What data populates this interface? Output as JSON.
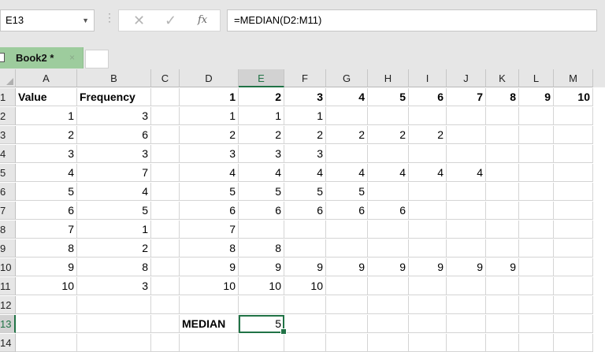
{
  "formula_bar": {
    "name_box": "E13",
    "name_box_arrow": "▼",
    "separator": "⋮",
    "cancel_icon": "✕",
    "enter_icon": "✓",
    "fx_label": "fx",
    "formula": "=MEDIAN(D2:M11)"
  },
  "workbook_tab": {
    "label": "Book2 *",
    "close": "×"
  },
  "columns": [
    "A",
    "B",
    "C",
    "D",
    "E",
    "F",
    "G",
    "H",
    "I",
    "J",
    "K",
    "L",
    "M"
  ],
  "row_numbers": [
    "1",
    "2",
    "3",
    "4",
    "5",
    "6",
    "7",
    "8",
    "9",
    "10",
    "11",
    "12",
    "13",
    "14"
  ],
  "selection": {
    "cell": "E13",
    "column": "E",
    "row": "13",
    "accent": "#217346"
  },
  "cells": {
    "A1": "Value",
    "B1": "Frequency",
    "D1": "1",
    "E1": "2",
    "F1": "3",
    "G1": "4",
    "H1": "5",
    "I1": "6",
    "J1": "7",
    "K1": "8",
    "L1": "9",
    "M1": "10",
    "A2": "1",
    "B2": "3",
    "D2": "1",
    "E2": "1",
    "F2": "1",
    "A3": "2",
    "B3": "6",
    "D3": "2",
    "E3": "2",
    "F3": "2",
    "G3": "2",
    "H3": "2",
    "I3": "2",
    "A4": "3",
    "B4": "3",
    "D4": "3",
    "E4": "3",
    "F4": "3",
    "A5": "4",
    "B5": "7",
    "D5": "4",
    "E5": "4",
    "F5": "4",
    "G5": "4",
    "H5": "4",
    "I5": "4",
    "J5": "4",
    "A6": "5",
    "B6": "4",
    "D6": "5",
    "E6": "5",
    "F6": "5",
    "G6": "5",
    "A7": "6",
    "B7": "5",
    "D7": "6",
    "E7": "6",
    "F7": "6",
    "G7": "6",
    "H7": "6",
    "A8": "7",
    "B8": "1",
    "D8": "7",
    "A9": "8",
    "B9": "2",
    "D9": "8",
    "E9": "8",
    "A10": "9",
    "B10": "8",
    "D10": "9",
    "E10": "9",
    "F10": "9",
    "G10": "9",
    "H10": "9",
    "I10": "9",
    "J10": "9",
    "K10": "9",
    "A11": "10",
    "B11": "3",
    "D11": "10",
    "E11": "10",
    "F11": "10",
    "D13": "MEDIAN",
    "E13": "5"
  }
}
